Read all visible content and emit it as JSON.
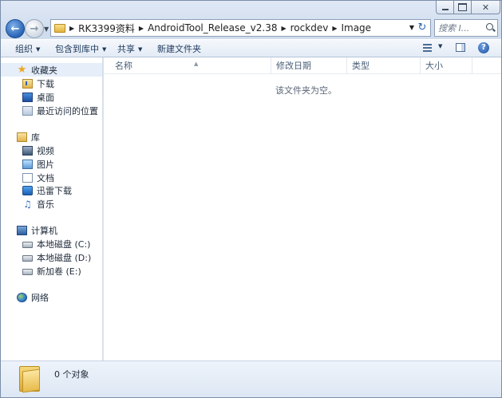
{
  "window": {
    "controls": {
      "minimize": "minimize-icon",
      "maximize": "maximize-icon",
      "close": "✕"
    }
  },
  "nav": {
    "back_icon": "back-arrow-icon",
    "forward_icon": "forward-arrow-icon",
    "breadcrumb": [
      "RK3399资料",
      "AndroidTool_Release_v2.38",
      "rockdev",
      "Image"
    ],
    "search_placeholder": "搜索 I..."
  },
  "toolbar": {
    "organize": "组织",
    "include_in_library": "包含到库中",
    "share": "共享",
    "new_folder": "新建文件夹"
  },
  "sidebar": {
    "favorites": {
      "label": "收藏夹",
      "items": [
        "下载",
        "桌面",
        "最近访问的位置"
      ]
    },
    "libraries": {
      "label": "库",
      "items": [
        "视频",
        "图片",
        "文档",
        "迅雷下载",
        "音乐"
      ]
    },
    "computer": {
      "label": "计算机",
      "items": [
        "本地磁盘 (C:)",
        "本地磁盘 (D:)",
        "新加卷 (E:)"
      ]
    },
    "network": {
      "label": "网络"
    }
  },
  "content": {
    "columns": [
      "名称",
      "修改日期",
      "类型",
      "大小"
    ],
    "empty_message": "该文件夹为空。"
  },
  "details": {
    "item_count": "0 个对象"
  }
}
